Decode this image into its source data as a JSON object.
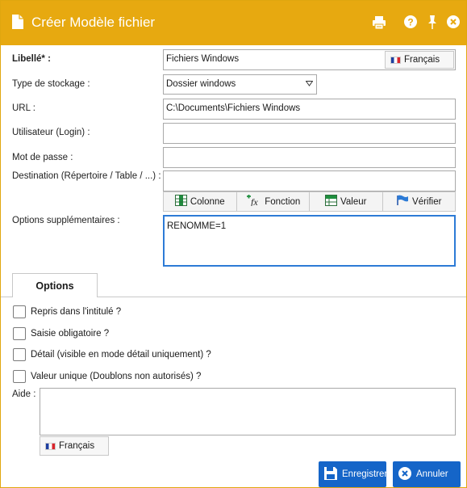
{
  "title": "Créer Modèle fichier",
  "colors": {
    "titlebar": "#e7a910",
    "accent": "#1565c8"
  },
  "labels": {
    "libelle": "Libellé* :",
    "type_stockage": "Type de stockage :",
    "url": "URL :",
    "utilisateur": "Utilisateur (Login) :",
    "mot_de_passe": "Mot de passe :",
    "destination": "Destination (Répertoire / Table / ...) :",
    "options_sup": "Options supplémentaires :",
    "aide": "Aide :"
  },
  "values": {
    "libelle": "Fichiers Windows",
    "type_stockage": "Dossier windows",
    "url": "C:\\Documents\\Fichiers Windows",
    "utilisateur": "",
    "mot_de_passe": "",
    "destination": "",
    "options_sup": "RENOMME=1",
    "aide": ""
  },
  "lang_button": "Français",
  "toolbar_buttons": {
    "colonne": "Colonne",
    "fonction": "Fonction",
    "valeur": "Valeur",
    "verifier": "Vérifier"
  },
  "tab": "Options",
  "checkboxes": {
    "repris": "Repris dans l'intitulé ?",
    "saisie": "Saisie obligatoire ?",
    "detail": "Détail (visible en mode détail uniquement) ?",
    "unique": "Valeur unique (Doublons non autorisés) ?"
  },
  "buttons": {
    "enregistrer": "Enregistrer",
    "annuler": "Annuler"
  }
}
